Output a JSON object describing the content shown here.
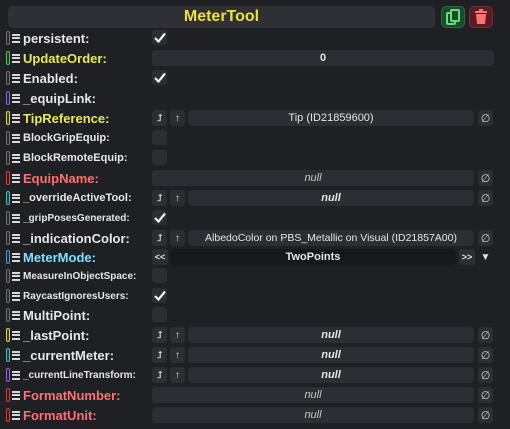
{
  "header": {
    "title": "MeterTool"
  },
  "icons": {
    "duplicate": "duplicate-icon",
    "delete": "trash-icon",
    "check": "checkmark-icon",
    "set_reference": "jump-arrow-icon",
    "up": "up-arrow-icon",
    "null_btn": "null-set-icon"
  },
  "rows": {
    "persistent": {
      "label": "persistent:",
      "checked": true
    },
    "update_order": {
      "label": "UpdateOrder:",
      "value": "0"
    },
    "enabled": {
      "label": "Enabled:",
      "checked": true
    },
    "equip_link": {
      "label": "_equipLink:"
    },
    "tip_reference": {
      "label": "TipReference:",
      "value": "Tip (ID21859600)"
    },
    "block_grip_equip": {
      "label": "BlockGripEquip:",
      "checked": false
    },
    "block_remote_equip": {
      "label": "BlockRemoteEquip:",
      "checked": false
    },
    "equip_name": {
      "label": "EquipName:",
      "value": "null"
    },
    "override_active_tool": {
      "label": "_overrideActiveTool:",
      "value": "null"
    },
    "grip_poses_generated": {
      "label": "_gripPosesGenerated:",
      "checked": true
    },
    "indication_color": {
      "label": "_indicationColor:",
      "value": "AlbedoColor on PBS_Metallic on Visual (ID21857A00)"
    },
    "meter_mode": {
      "label": "MeterMode:",
      "value": "TwoPoints",
      "prev": "<<",
      "next": ">>",
      "drop": "▼"
    },
    "measure_in_object_space": {
      "label": "MeasureInObjectSpace:",
      "checked": false
    },
    "raycast_ignores_users": {
      "label": "RaycastIgnoresUsers:",
      "checked": true
    },
    "multi_point": {
      "label": "MultiPoint:",
      "checked": false
    },
    "last_point": {
      "label": "_lastPoint:",
      "value": "null"
    },
    "current_meter": {
      "label": "_currentMeter:",
      "value": "null"
    },
    "current_line_transform": {
      "label": "_currentLineTransform:",
      "value": "null"
    },
    "format_number": {
      "label": "FormatNumber:",
      "value": "null"
    },
    "format_unit": {
      "label": "FormatUnit:",
      "value": "null"
    }
  },
  "colors": {
    "title": "#f0e040",
    "background": "#1f2024",
    "field": "#2c2e33",
    "duplicate_button": "#1d4a2a",
    "delete_button": "#5a1d22"
  }
}
